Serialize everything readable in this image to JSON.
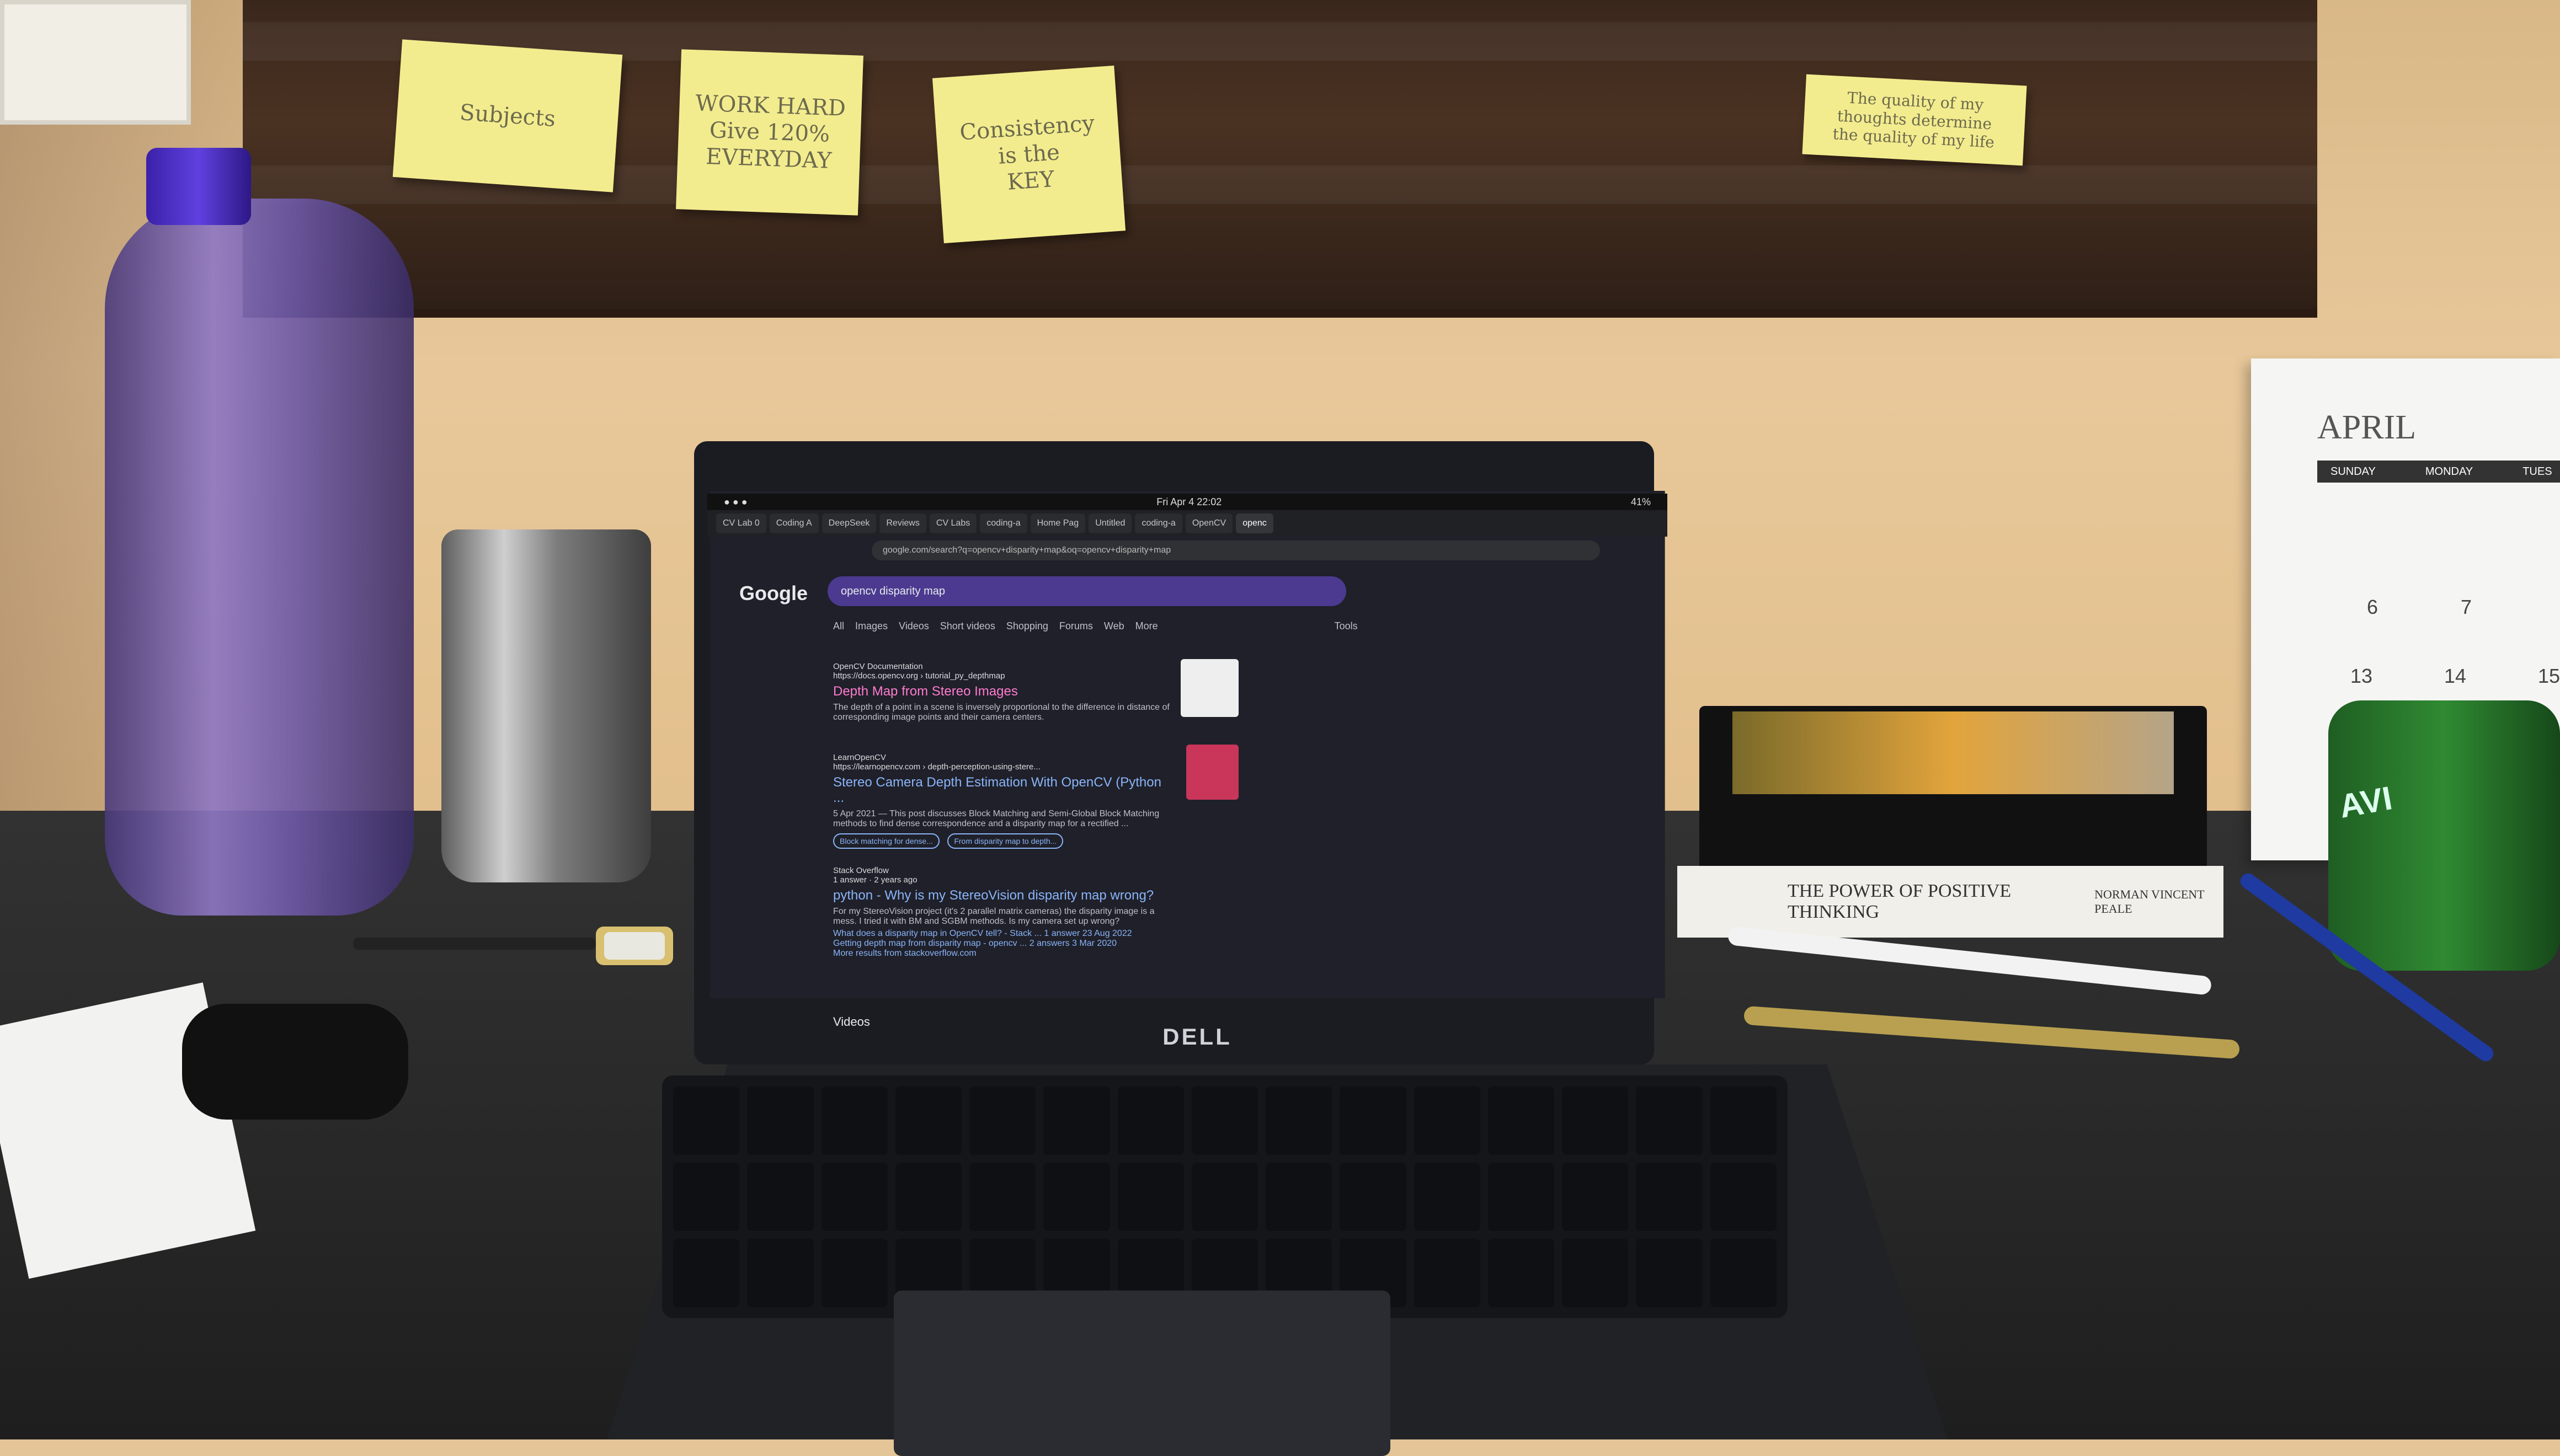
{
  "sticky_notes": [
    {
      "text": "Subjects"
    },
    {
      "text": "WORK HARD\nGive 120%\nEVERYDAY"
    },
    {
      "text": "Consistency\nis the\nKEY"
    },
    {
      "text": "The quality of my\nthoughts determine\nthe quality of my life"
    }
  ],
  "laptop": {
    "brand": "DELL",
    "topbar": {
      "datetime": "Fri Apr 4 22:02",
      "battery": "41%"
    },
    "tabs": [
      "CV Lab 0",
      "Coding A",
      "DeepSeek",
      "Reviews",
      "CV Labs",
      "coding-a",
      "Home Pag",
      "Untitled",
      "coding-a",
      "OpenCV",
      "openc"
    ],
    "url": "google.com/search?q=opencv+disparity+map&oq=opencv+disparity+map",
    "search_query": "opencv disparity map",
    "filters": [
      "All",
      "Images",
      "Videos",
      "Short videos",
      "Shopping",
      "Forums",
      "Web",
      "More"
    ],
    "tools_label": "Tools",
    "results": [
      {
        "source": "OpenCV Documentation",
        "url": "https://docs.opencv.org › tutorial_py_depthmap",
        "title": "Depth Map from Stereo Images",
        "snippet": "The depth of a point in a scene is inversely proportional to the difference in distance of corresponding image points and their camera centers."
      },
      {
        "source": "LearnOpenCV",
        "url": "https://learnopencv.com › depth-perception-using-stere...",
        "title": "Stereo Camera Depth Estimation With OpenCV (Python ...",
        "snippet": "5 Apr 2021 — This post discusses Block Matching and Semi-Global Block Matching methods to find dense correspondence and a disparity map for a rectified ...",
        "chips": [
          "Block matching for dense...",
          "From disparity map to depth..."
        ]
      },
      {
        "source": "Stack Overflow",
        "url": "1 answer · 2 years ago",
        "title": "python - Why is my StereoVision disparity map wrong?",
        "snippet": "For my StereoVision project (it's 2 parallel matrix cameras) the disparity image is a mess. I tried it with BM and SGBM methods. Is my camera set up wrong?",
        "related": [
          "What does a disparity map in OpenCV tell? - Stack ...   1 answer   23 Aug 2022",
          "Getting depth map from disparity map - opencv ...   2 answers   3 Mar 2020"
        ],
        "more": "More results from stackoverflow.com"
      }
    ],
    "next_section": "Videos"
  },
  "calendar": {
    "month": "APRIL",
    "days": [
      "SUNDAY",
      "MONDAY",
      "TUES"
    ],
    "dates": [
      "6",
      "7",
      "13",
      "14",
      "15"
    ]
  },
  "book": {
    "title": "THE POWER OF POSITIVE THINKING",
    "author": "NORMAN VINCENT PEALE"
  },
  "speaker_label": "AVI"
}
